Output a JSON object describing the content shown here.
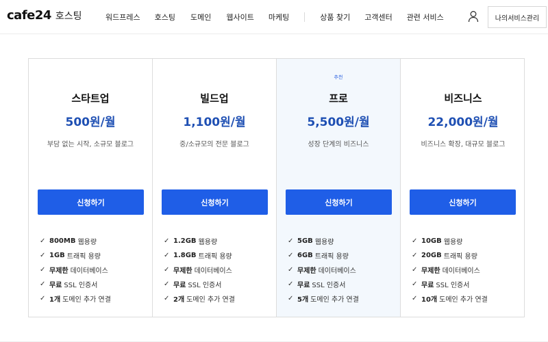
{
  "header": {
    "logo_mark": "cafe24",
    "logo_sub": "호스팅",
    "nav": [
      "워드프레스",
      "호스팅",
      "도메인",
      "웹사이트",
      "마케팅"
    ],
    "nav_secondary": [
      "상품 찾기",
      "고객센터",
      "관련 서비스"
    ],
    "service_button": "나의서비스관리"
  },
  "plans": [
    {
      "badge": "",
      "name": "스타트업",
      "price": "500원/월",
      "desc": "부담 없는 시작, 소규모 블로그",
      "button": "신청하기",
      "features": [
        {
          "strong": "800MB",
          "rest": "웹용량"
        },
        {
          "strong": "1GB",
          "rest": "트래픽 용량"
        },
        {
          "strong": "무제한",
          "rest": "데이터베이스"
        },
        {
          "strong": "무료",
          "rest": "SSL 인증서"
        },
        {
          "strong": "1개",
          "rest": "도메인 추가 연결"
        }
      ]
    },
    {
      "badge": "",
      "name": "빌드업",
      "price": "1,100원/월",
      "desc": "중/소규모의 전문 블로그",
      "button": "신청하기",
      "features": [
        {
          "strong": "1.2GB",
          "rest": "웹용량"
        },
        {
          "strong": "1.8GB",
          "rest": "트래픽 용량"
        },
        {
          "strong": "무제한",
          "rest": "데이터베이스"
        },
        {
          "strong": "무료",
          "rest": "SSL 인증서"
        },
        {
          "strong": "2개",
          "rest": "도메인 추가 연결"
        }
      ]
    },
    {
      "badge": "추천",
      "name": "프로",
      "price": "5,500원/월",
      "desc": "성장 단계의 비즈니스",
      "button": "신청하기",
      "features": [
        {
          "strong": "5GB",
          "rest": "웹용량"
        },
        {
          "strong": "6GB",
          "rest": "트래픽 용량"
        },
        {
          "strong": "무제한",
          "rest": "데이터베이스"
        },
        {
          "strong": "무료",
          "rest": "SSL 인증서"
        },
        {
          "strong": "5개",
          "rest": "도메인 추가 연결"
        }
      ]
    },
    {
      "badge": "",
      "name": "비즈니스",
      "price": "22,000원/월",
      "desc": "비즈니스 확장, 대규모 블로그",
      "button": "신청하기",
      "features": [
        {
          "strong": "10GB",
          "rest": "웹용량"
        },
        {
          "strong": "20GB",
          "rest": "트래픽 용량"
        },
        {
          "strong": "무제한",
          "rest": "데이터베이스"
        },
        {
          "strong": "무료",
          "rest": "SSL 인증서"
        },
        {
          "strong": "10개",
          "rest": "도메인 추가 연결"
        }
      ]
    }
  ],
  "colors": {
    "accent": "#1f5ee7",
    "price": "#1e4fb3",
    "featured_bg": "#f3f8fd"
  }
}
